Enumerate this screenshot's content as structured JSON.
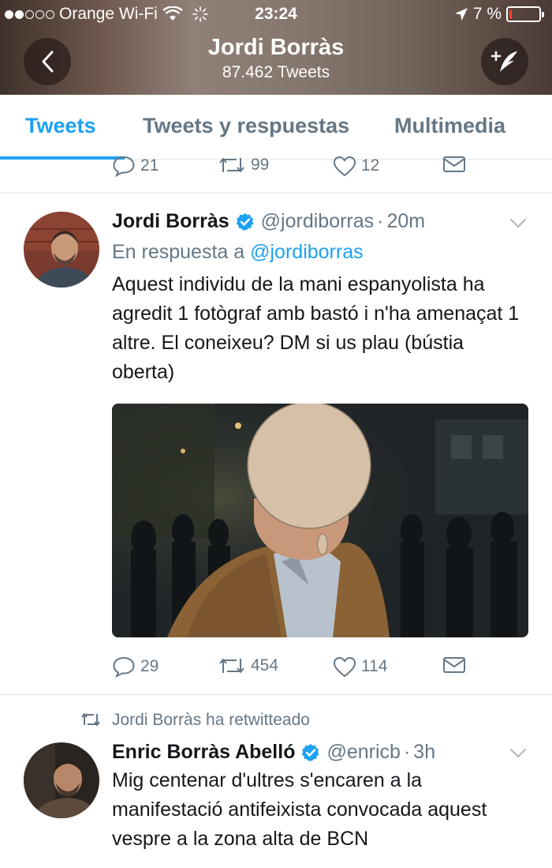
{
  "status_bar": {
    "carrier": "Orange Wi-Fi",
    "time": "23:24",
    "battery": "7 %",
    "battery_level": 0.07,
    "signal_bars_filled": 2,
    "signal_bars_total": 5
  },
  "nav": {
    "title": "Jordi Borràs",
    "subtitle": "87.462 Tweets",
    "back_icon": "chevron-left-icon",
    "compose_icon": "compose-tweet-icon"
  },
  "tabs": [
    {
      "label": "Tweets",
      "active": true
    },
    {
      "label": "Tweets y respuestas",
      "active": false
    },
    {
      "label": "Multimedia",
      "active": false
    }
  ],
  "previous_tweet": {
    "reply_count": "21",
    "retweet_count": "99",
    "like_count": "12"
  },
  "tweet1": {
    "name": "Jordi Borràs",
    "handle": "@jordiborras",
    "separator": "·",
    "time": "20m",
    "reply_prefix": "En respuesta a",
    "reply_mention": "@jordiborras",
    "text": "Aquest individu de la mani espanyolista ha agredit 1 fotògraf amb bastó i n'ha amenaçat 1 altre. El coneixeu? DM si us plau (bústia oberta)",
    "reply_count": "29",
    "retweet_count": "454",
    "like_count": "114"
  },
  "tweet2": {
    "retweet_label": "Jordi Borràs ha retwitteado",
    "name": "Enric Borràs Abelló",
    "handle": "@enricb",
    "separator": "·",
    "time": "3h",
    "text": "Mig centenar d'ultres s'encaren a la manifestació antifeixista convocada aquest vespre a la zona alta de BCN"
  },
  "colors": {
    "accent": "#1da1f2",
    "secondary_text": "#657786",
    "primary_text": "#14171a",
    "divider": "#e1e8ed",
    "battery_low": "#ff3b30"
  }
}
